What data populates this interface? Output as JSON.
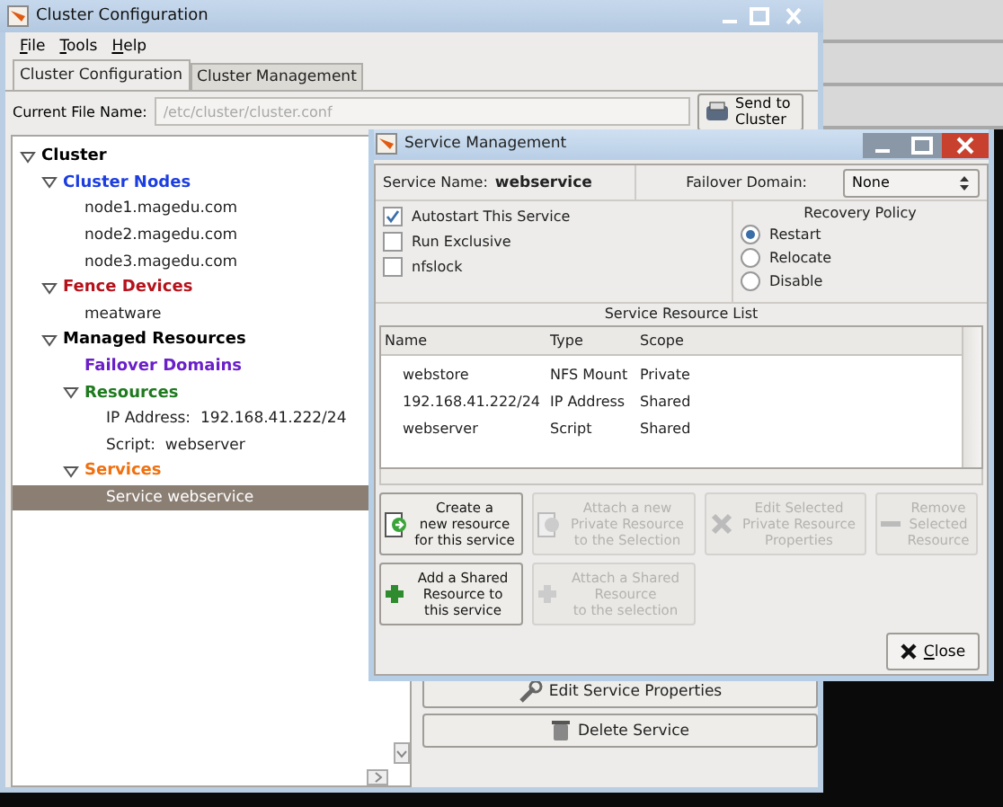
{
  "main_window": {
    "title": "Cluster Configuration"
  },
  "menu": [
    "File",
    "Tools",
    "Help"
  ],
  "tabs": [
    {
      "label": "Cluster Configuration",
      "selected": true
    },
    {
      "label": "Cluster Management",
      "selected": false
    }
  ],
  "file_name": {
    "label": "Current File Name:",
    "value": "/etc/cluster/cluster.conf",
    "disabled": true
  },
  "send_button": "Send to Cluster",
  "tree": [
    {
      "label": "Cluster",
      "kind": "category",
      "color": "#000000",
      "expanded": true,
      "selected": false,
      "children": [
        {
          "label": "Cluster Nodes",
          "kind": "category",
          "color": "#1c3ee0",
          "expanded": true,
          "selected": false,
          "children": [
            {
              "label": "node1.magedu.com",
              "kind": "item",
              "selected": false
            },
            {
              "label": "node2.magedu.com",
              "kind": "item",
              "selected": false
            },
            {
              "label": "node3.magedu.com",
              "kind": "item",
              "selected": false
            }
          ]
        },
        {
          "label": "Fence Devices",
          "kind": "category",
          "color": "#b5121b",
          "expanded": true,
          "selected": false,
          "children": [
            {
              "label": "meatware",
              "kind": "item",
              "selected": false
            }
          ]
        },
        {
          "label": "Managed Resources",
          "kind": "category",
          "color": "#000000",
          "expanded": true,
          "selected": false,
          "children": [
            {
              "label": "Failover Domains",
              "kind": "category",
              "color": "#6a1fc8",
              "selected": false
            },
            {
              "label": "Resources",
              "kind": "category",
              "color": "#1e7a1e",
              "expanded": true,
              "selected": false,
              "children": [
                {
                  "label": "IP Address:  192.168.41.222/24",
                  "kind": "item",
                  "selected": false
                },
                {
                  "label": "Script:  webserver",
                  "kind": "item",
                  "selected": false
                }
              ]
            },
            {
              "label": "Services",
              "kind": "category",
              "color": "#f07010",
              "expanded": true,
              "selected": false,
              "children": [
                {
                  "label": "Service webservice",
                  "kind": "item",
                  "selected": true
                }
              ]
            }
          ]
        }
      ]
    }
  ],
  "service_buttons": [
    {
      "label": "Edit Service Properties",
      "kind": "edit"
    },
    {
      "label": "Delete Service",
      "kind": "delete"
    }
  ],
  "dialog": {
    "title": "Service Management",
    "service_name_label": "Service Name:",
    "service_name": "webservice",
    "failover_label": "Failover Domain:",
    "failover_value": "None",
    "options": [
      {
        "label": "Autostart This Service",
        "checked": true
      },
      {
        "label": "Run Exclusive",
        "checked": false
      },
      {
        "label": "nfslock",
        "checked": false
      }
    ],
    "recovery": {
      "title": "Recovery Policy",
      "options": [
        {
          "label": "Restart",
          "selected": true
        },
        {
          "label": "Relocate",
          "selected": false
        },
        {
          "label": "Disable",
          "selected": false
        }
      ]
    },
    "resource_list": {
      "title": "Service Resource List",
      "columns": [
        "Name",
        "Type",
        "Scope"
      ],
      "rows": [
        [
          "webstore",
          "NFS Mount",
          "Private"
        ],
        [
          "192.168.41.222/24",
          "IP Address",
          "Shared"
        ],
        [
          "webserver",
          "Script",
          "Shared"
        ]
      ]
    },
    "actions": [
      {
        "label": "Create a\nnew resource\nfor this service",
        "kind": "create",
        "disabled": false
      },
      {
        "label": "Attach a new\nPrivate Resource\nto the Selection",
        "kind": "attach",
        "disabled": true
      },
      {
        "label": "Edit Selected\nPrivate Resource\nProperties",
        "kind": "edit",
        "disabled": true
      },
      {
        "label": "Remove\nSelected\nResource",
        "kind": "remove",
        "disabled": true
      },
      {
        "label": "Add a Shared\nResource to\nthis service",
        "kind": "add",
        "disabled": false
      },
      {
        "label": "Attach a Shared\nResource\nto the selection",
        "kind": "attach_shared",
        "disabled": true
      }
    ],
    "close": "Close"
  }
}
